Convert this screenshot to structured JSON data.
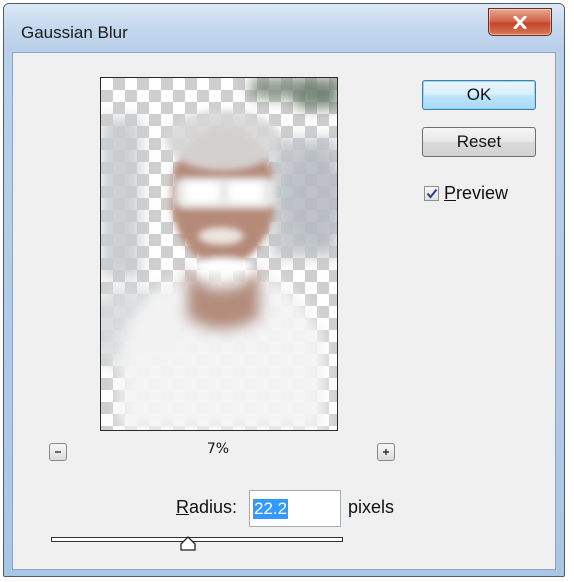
{
  "window": {
    "title": "Gaussian Blur",
    "close_icon": "close-x-icon"
  },
  "buttons": {
    "ok_label": "OK",
    "reset_label": "Reset"
  },
  "preview_option": {
    "label": "Preview",
    "mnemonic": "P",
    "rest": "review",
    "checked": true
  },
  "zoom": {
    "level": "7%",
    "zoom_out_icon": "minus-icon",
    "zoom_in_icon": "plus-icon"
  },
  "radius": {
    "label": "Radius:",
    "mnemonic": "R",
    "rest": "adius:",
    "value": "22.2",
    "unit": "pixels",
    "slider_fraction": 0.47
  },
  "colors": {
    "accent_selection": "#3399ff",
    "ok_button_border": "#3c7fb1",
    "close_button": "#c2452a"
  }
}
